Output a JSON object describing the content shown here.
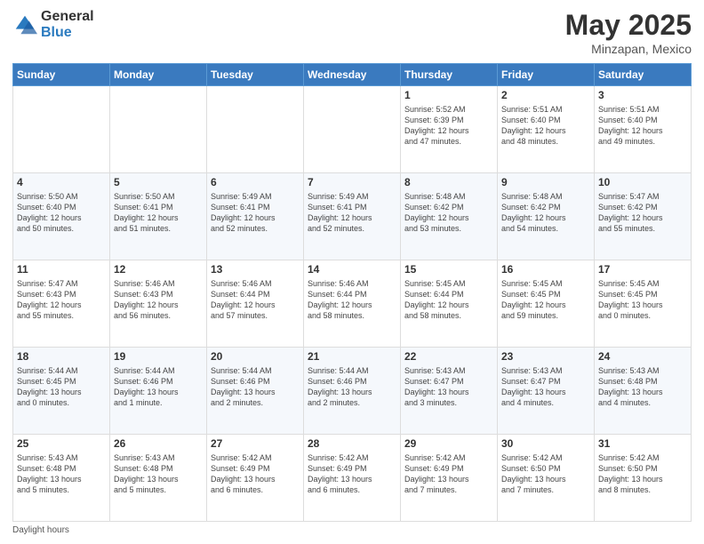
{
  "logo": {
    "general": "General",
    "blue": "Blue"
  },
  "title": "May 2025",
  "subtitle": "Minzapan, Mexico",
  "weekdays": [
    "Sunday",
    "Monday",
    "Tuesday",
    "Wednesday",
    "Thursday",
    "Friday",
    "Saturday"
  ],
  "weeks": [
    [
      {
        "day": "",
        "info": ""
      },
      {
        "day": "",
        "info": ""
      },
      {
        "day": "",
        "info": ""
      },
      {
        "day": "",
        "info": ""
      },
      {
        "day": "1",
        "info": "Sunrise: 5:52 AM\nSunset: 6:39 PM\nDaylight: 12 hours\nand 47 minutes."
      },
      {
        "day": "2",
        "info": "Sunrise: 5:51 AM\nSunset: 6:40 PM\nDaylight: 12 hours\nand 48 minutes."
      },
      {
        "day": "3",
        "info": "Sunrise: 5:51 AM\nSunset: 6:40 PM\nDaylight: 12 hours\nand 49 minutes."
      }
    ],
    [
      {
        "day": "4",
        "info": "Sunrise: 5:50 AM\nSunset: 6:40 PM\nDaylight: 12 hours\nand 50 minutes."
      },
      {
        "day": "5",
        "info": "Sunrise: 5:50 AM\nSunset: 6:41 PM\nDaylight: 12 hours\nand 51 minutes."
      },
      {
        "day": "6",
        "info": "Sunrise: 5:49 AM\nSunset: 6:41 PM\nDaylight: 12 hours\nand 52 minutes."
      },
      {
        "day": "7",
        "info": "Sunrise: 5:49 AM\nSunset: 6:41 PM\nDaylight: 12 hours\nand 52 minutes."
      },
      {
        "day": "8",
        "info": "Sunrise: 5:48 AM\nSunset: 6:42 PM\nDaylight: 12 hours\nand 53 minutes."
      },
      {
        "day": "9",
        "info": "Sunrise: 5:48 AM\nSunset: 6:42 PM\nDaylight: 12 hours\nand 54 minutes."
      },
      {
        "day": "10",
        "info": "Sunrise: 5:47 AM\nSunset: 6:42 PM\nDaylight: 12 hours\nand 55 minutes."
      }
    ],
    [
      {
        "day": "11",
        "info": "Sunrise: 5:47 AM\nSunset: 6:43 PM\nDaylight: 12 hours\nand 55 minutes."
      },
      {
        "day": "12",
        "info": "Sunrise: 5:46 AM\nSunset: 6:43 PM\nDaylight: 12 hours\nand 56 minutes."
      },
      {
        "day": "13",
        "info": "Sunrise: 5:46 AM\nSunset: 6:44 PM\nDaylight: 12 hours\nand 57 minutes."
      },
      {
        "day": "14",
        "info": "Sunrise: 5:46 AM\nSunset: 6:44 PM\nDaylight: 12 hours\nand 58 minutes."
      },
      {
        "day": "15",
        "info": "Sunrise: 5:45 AM\nSunset: 6:44 PM\nDaylight: 12 hours\nand 58 minutes."
      },
      {
        "day": "16",
        "info": "Sunrise: 5:45 AM\nSunset: 6:45 PM\nDaylight: 12 hours\nand 59 minutes."
      },
      {
        "day": "17",
        "info": "Sunrise: 5:45 AM\nSunset: 6:45 PM\nDaylight: 13 hours\nand 0 minutes."
      }
    ],
    [
      {
        "day": "18",
        "info": "Sunrise: 5:44 AM\nSunset: 6:45 PM\nDaylight: 13 hours\nand 0 minutes."
      },
      {
        "day": "19",
        "info": "Sunrise: 5:44 AM\nSunset: 6:46 PM\nDaylight: 13 hours\nand 1 minute."
      },
      {
        "day": "20",
        "info": "Sunrise: 5:44 AM\nSunset: 6:46 PM\nDaylight: 13 hours\nand 2 minutes."
      },
      {
        "day": "21",
        "info": "Sunrise: 5:44 AM\nSunset: 6:46 PM\nDaylight: 13 hours\nand 2 minutes."
      },
      {
        "day": "22",
        "info": "Sunrise: 5:43 AM\nSunset: 6:47 PM\nDaylight: 13 hours\nand 3 minutes."
      },
      {
        "day": "23",
        "info": "Sunrise: 5:43 AM\nSunset: 6:47 PM\nDaylight: 13 hours\nand 4 minutes."
      },
      {
        "day": "24",
        "info": "Sunrise: 5:43 AM\nSunset: 6:48 PM\nDaylight: 13 hours\nand 4 minutes."
      }
    ],
    [
      {
        "day": "25",
        "info": "Sunrise: 5:43 AM\nSunset: 6:48 PM\nDaylight: 13 hours\nand 5 minutes."
      },
      {
        "day": "26",
        "info": "Sunrise: 5:43 AM\nSunset: 6:48 PM\nDaylight: 13 hours\nand 5 minutes."
      },
      {
        "day": "27",
        "info": "Sunrise: 5:42 AM\nSunset: 6:49 PM\nDaylight: 13 hours\nand 6 minutes."
      },
      {
        "day": "28",
        "info": "Sunrise: 5:42 AM\nSunset: 6:49 PM\nDaylight: 13 hours\nand 6 minutes."
      },
      {
        "day": "29",
        "info": "Sunrise: 5:42 AM\nSunset: 6:49 PM\nDaylight: 13 hours\nand 7 minutes."
      },
      {
        "day": "30",
        "info": "Sunrise: 5:42 AM\nSunset: 6:50 PM\nDaylight: 13 hours\nand 7 minutes."
      },
      {
        "day": "31",
        "info": "Sunrise: 5:42 AM\nSunset: 6:50 PM\nDaylight: 13 hours\nand 8 minutes."
      }
    ]
  ],
  "legend": {
    "daylight_label": "Daylight hours"
  }
}
